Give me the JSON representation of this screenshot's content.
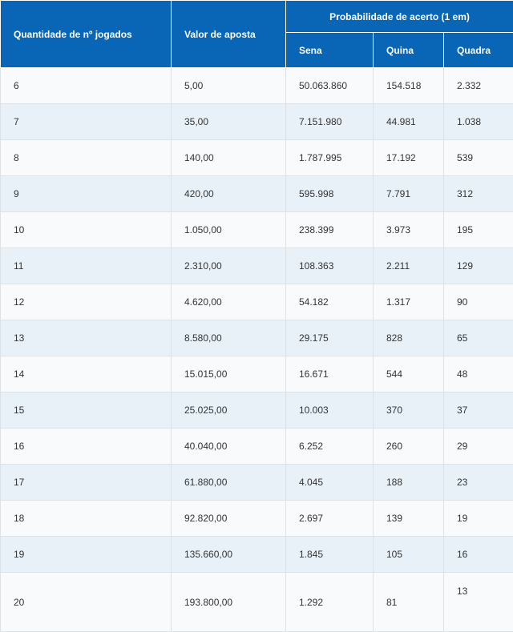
{
  "headers": {
    "quantity": "Quantidade de nº jogados",
    "bet_value": "Valor de aposta",
    "probability_group": "Probabilidade de acerto (1 em)",
    "sena": "Sena",
    "quina": "Quina",
    "quadra": "Quadra"
  },
  "rows": [
    {
      "qty": "6",
      "value": "5,00",
      "sena": "50.063.860",
      "quina": "154.518",
      "quadra": "2.332"
    },
    {
      "qty": "7",
      "value": "35,00",
      "sena": "7.151.980",
      "quina": "44.981",
      "quadra": "1.038"
    },
    {
      "qty": "8",
      "value": "140,00",
      "sena": "1.787.995",
      "quina": "17.192",
      "quadra": "539"
    },
    {
      "qty": "9",
      "value": "420,00",
      "sena": "595.998",
      "quina": "7.791",
      "quadra": "312"
    },
    {
      "qty": "10",
      "value": "1.050,00",
      "sena": "238.399",
      "quina": "3.973",
      "quadra": "195"
    },
    {
      "qty": "11",
      "value": "2.310,00",
      "sena": "108.363",
      "quina": "2.211",
      "quadra": "129"
    },
    {
      "qty": "12",
      "value": "4.620,00",
      "sena": "54.182",
      "quina": "1.317",
      "quadra": "90"
    },
    {
      "qty": "13",
      "value": "8.580,00",
      "sena": "29.175",
      "quina": "828",
      "quadra": "65"
    },
    {
      "qty": "14",
      "value": "15.015,00",
      "sena": "16.671",
      "quina": "544",
      "quadra": "48"
    },
    {
      "qty": "15",
      "value": "25.025,00",
      "sena": "10.003",
      "quina": "370",
      "quadra": "37"
    },
    {
      "qty": "16",
      "value": "40.040,00",
      "sena": "6.252",
      "quina": "260",
      "quadra": "29"
    },
    {
      "qty": "17",
      "value": "61.880,00",
      "sena": "4.045",
      "quina": "188",
      "quadra": "23"
    },
    {
      "qty": "18",
      "value": "92.820,00",
      "sena": "2.697",
      "quina": "139",
      "quadra": "19"
    },
    {
      "qty": "19",
      "value": "135.660,00",
      "sena": "1.845",
      "quina": "105",
      "quadra": "16"
    },
    {
      "qty": "20",
      "value": "193.800,00",
      "sena": "1.292",
      "quina": "81",
      "quadra": "13"
    }
  ]
}
